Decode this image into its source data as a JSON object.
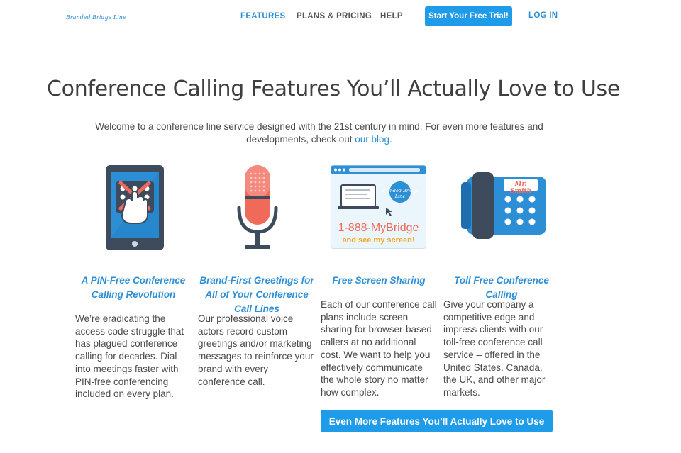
{
  "header": {
    "logo_text": "Branded Bridge Line",
    "nav": {
      "features": "FEATURES",
      "plans": "PLANS & PRICING",
      "help": "HELP"
    },
    "trial_button": "Start Your Free Trial!",
    "login": "LOG IN"
  },
  "main": {
    "title": "Conference Calling Features You’ll Actually Love to Use",
    "intro_text": "Welcome to a conference line service designed with the 21st century in mind. For even more features and developments, check out ",
    "intro_link": "our blog",
    "intro_end": ".",
    "features": [
      {
        "icon": "tablet-no-pin-icon",
        "title": "A PIN-Free Conference Calling Revolution",
        "text": "We’re eradicating the access code struggle that has plagued conference calling for decades. Dial into meetings faster with PIN-free conferencing included on every plan."
      },
      {
        "icon": "microphone-icon",
        "title": "Brand-First Greetings for All of Your Conference Call Lines",
        "text": "Our professional voice actors record custom greetings and/or marketing messages to reinforce your brand with every conference call."
      },
      {
        "icon": "screen-share-icon",
        "title": "Free Screen Sharing",
        "text": "Each of our conference call plans include screen sharing for browser-based callers at no additional cost. We want to help you effectively communicate the whole story no matter how complex.",
        "graphic_phone": "1-888-MyBridge",
        "graphic_caption": "and see my screen!",
        "graphic_logo": "Branded Bridge Line"
      },
      {
        "icon": "desk-phone-icon",
        "title": "Toll Free Conference Calling",
        "text": "Give your company a competitive edge and impress clients with our toll-free conference call service – offered in the United States, Canada, the UK, and other major markets.",
        "graphic_label": "Mr. Smith"
      }
    ],
    "more_button": "Even More Features You’ll Actually Love to Use"
  },
  "colors": {
    "brand_blue": "#2d8fd6",
    "button_blue": "#1e9be9",
    "mic_red": "#f06a5a",
    "dark_slate": "#3d4b5c"
  }
}
